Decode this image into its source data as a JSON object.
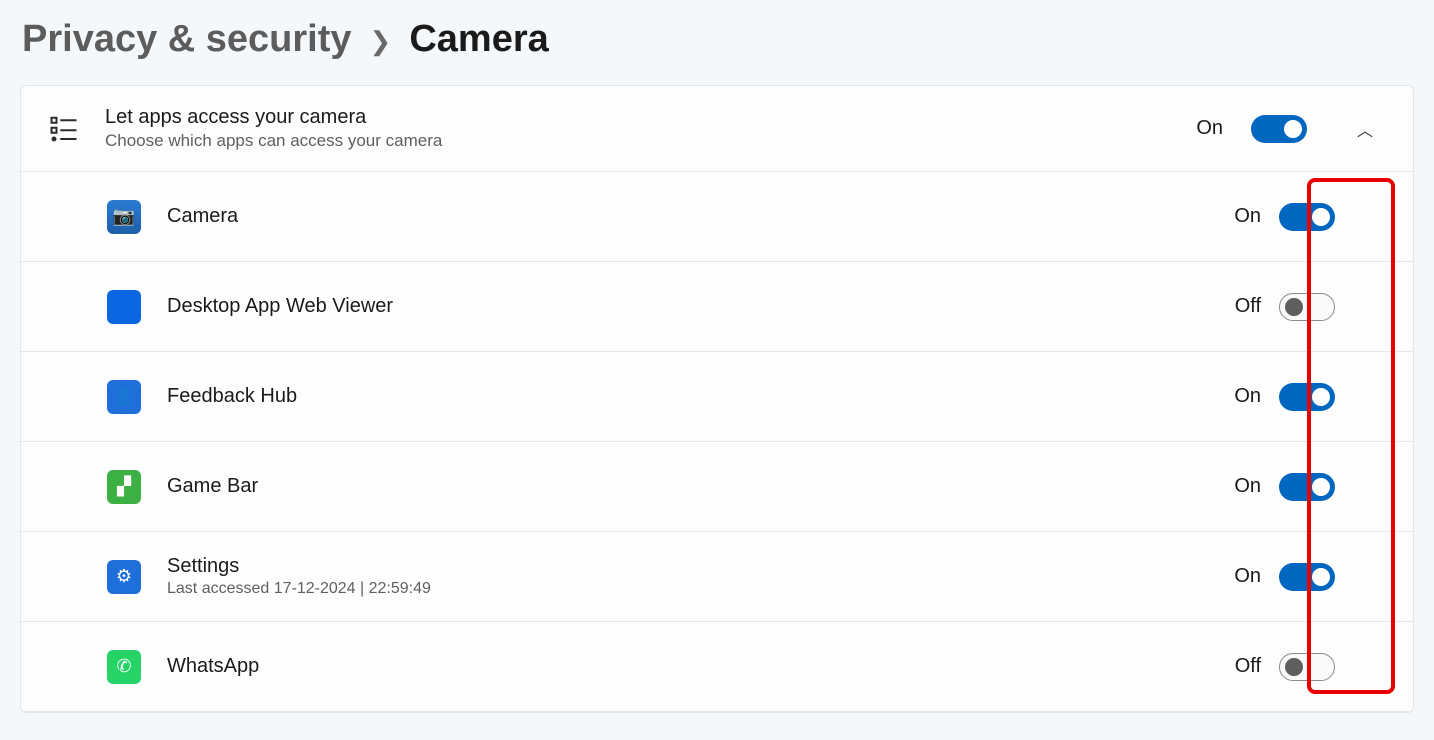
{
  "breadcrumb": {
    "parent": "Privacy & security",
    "current": "Camera"
  },
  "header": {
    "title": "Let apps access your camera",
    "subtitle": "Choose which apps can access your camera",
    "state_label": "On",
    "toggle_on": true
  },
  "state_labels": {
    "on": "On",
    "off": "Off"
  },
  "apps": [
    {
      "name": "Camera",
      "sub": "",
      "state": "On",
      "on": true,
      "icon": "ic-camera",
      "glyph": "📷"
    },
    {
      "name": "Desktop App Web Viewer",
      "sub": "",
      "state": "Off",
      "on": false,
      "icon": "ic-blue",
      "glyph": ""
    },
    {
      "name": "Feedback Hub",
      "sub": "",
      "state": "On",
      "on": true,
      "icon": "ic-feedback",
      "glyph": "👤"
    },
    {
      "name": "Game Bar",
      "sub": "",
      "state": "On",
      "on": true,
      "icon": "ic-gamebar",
      "glyph": "▞"
    },
    {
      "name": "Settings",
      "sub": "Last accessed 17-12-2024  |  22:59:49",
      "state": "On",
      "on": true,
      "icon": "ic-settings",
      "glyph": "⚙"
    },
    {
      "name": "WhatsApp",
      "sub": "",
      "state": "Off",
      "on": false,
      "icon": "ic-whatsapp",
      "glyph": "✆"
    }
  ]
}
